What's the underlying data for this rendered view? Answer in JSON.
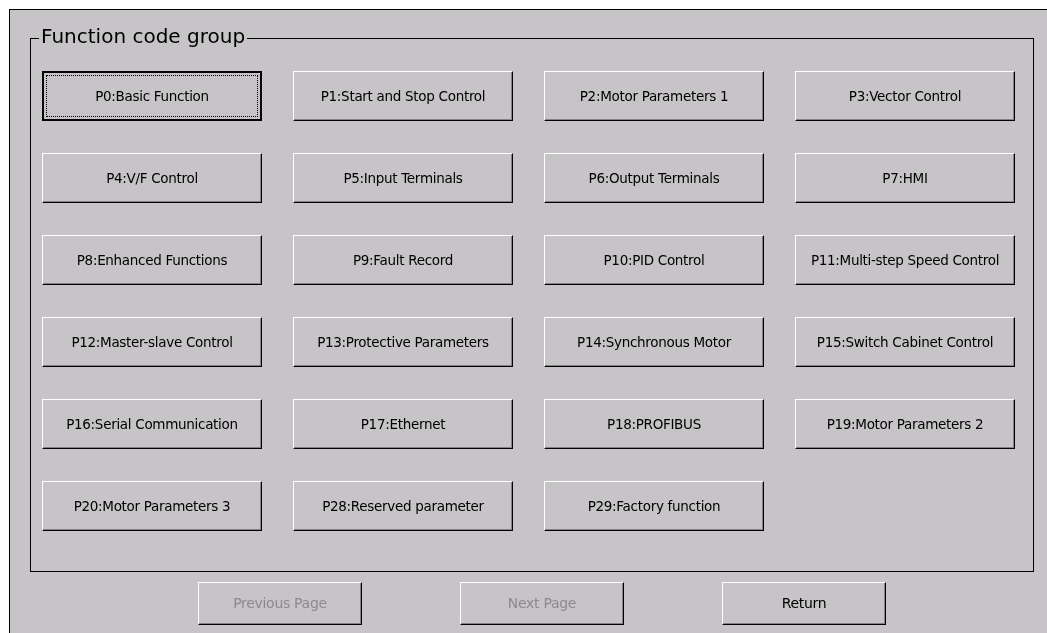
{
  "group": {
    "title": "Function code group",
    "buttons": [
      {
        "label": "P0:Basic Function",
        "focused": true
      },
      {
        "label": "P1:Start and Stop Control",
        "focused": false
      },
      {
        "label": "P2:Motor Parameters 1",
        "focused": false
      },
      {
        "label": "P3:Vector Control",
        "focused": false
      },
      {
        "label": "P4:V/F Control",
        "focused": false
      },
      {
        "label": "P5:Input Terminals",
        "focused": false
      },
      {
        "label": "P6:Output Terminals",
        "focused": false
      },
      {
        "label": "P7:HMI",
        "focused": false
      },
      {
        "label": "P8:Enhanced Functions",
        "focused": false
      },
      {
        "label": "P9:Fault Record",
        "focused": false
      },
      {
        "label": "P10:PID Control",
        "focused": false
      },
      {
        "label": "P11:Multi-step Speed Control",
        "focused": false
      },
      {
        "label": "P12:Master-slave Control",
        "focused": false
      },
      {
        "label": "P13:Protective Parameters",
        "focused": false
      },
      {
        "label": "P14:Synchronous Motor",
        "focused": false
      },
      {
        "label": "P15:Switch Cabinet Control",
        "focused": false
      },
      {
        "label": "P16:Serial Communication",
        "focused": false
      },
      {
        "label": "P17:Ethernet",
        "focused": false
      },
      {
        "label": "P18:PROFIBUS",
        "focused": false
      },
      {
        "label": "P19:Motor Parameters 2",
        "focused": false
      },
      {
        "label": "P20:Motor Parameters 3",
        "focused": false
      },
      {
        "label": "P28:Reserved parameter",
        "focused": false
      },
      {
        "label": "P29:Factory function",
        "focused": false
      }
    ]
  },
  "nav_buttons": [
    {
      "label": "Previous Page",
      "disabled": true
    },
    {
      "label": "Next Page",
      "disabled": true
    },
    {
      "label": "Return",
      "disabled": false
    }
  ]
}
